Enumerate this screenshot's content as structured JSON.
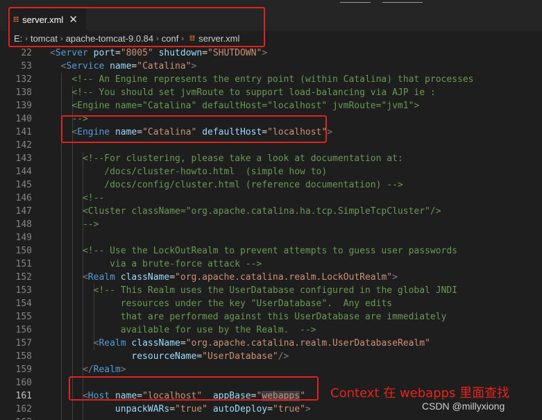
{
  "tab": {
    "file_name": "server.xml",
    "icon": "rss-icon",
    "close_label": "✕"
  },
  "breadcrumb": {
    "items": [
      "E:",
      "tomcat",
      "apache-tomcat-9.0.84",
      "conf",
      "server.xml"
    ],
    "separator": "›"
  },
  "editor": {
    "active_line": "161",
    "lines": [
      {
        "n": "22",
        "tokens": [
          {
            "t": "p",
            "v": "<"
          },
          {
            "t": "t",
            "v": "Server"
          },
          {
            "t": "txt",
            "v": " "
          },
          {
            "t": "a",
            "v": "port"
          },
          {
            "t": "txt",
            "v": "="
          },
          {
            "t": "s",
            "v": "\"8005\""
          },
          {
            "t": "txt",
            "v": " "
          },
          {
            "t": "a",
            "v": "shutdown"
          },
          {
            "t": "txt",
            "v": "="
          },
          {
            "t": "s",
            "v": "\"SHUTDOWN\""
          },
          {
            "t": "p",
            "v": ">"
          }
        ]
      },
      {
        "n": "53",
        "tokens": [
          {
            "t": "txt",
            "v": "  "
          },
          {
            "t": "p",
            "v": "<"
          },
          {
            "t": "t",
            "v": "Service"
          },
          {
            "t": "txt",
            "v": " "
          },
          {
            "t": "a",
            "v": "name"
          },
          {
            "t": "txt",
            "v": "="
          },
          {
            "t": "s",
            "v": "\"Catalina\""
          },
          {
            "t": "p",
            "v": ">"
          }
        ]
      },
      {
        "n": "132",
        "tokens": [
          {
            "t": "txt",
            "v": "    "
          },
          {
            "t": "c",
            "v": "<!-- An Engine represents the entry point (within Catalina) that processes"
          }
        ]
      },
      {
        "n": "138",
        "tokens": [
          {
            "t": "txt",
            "v": "    "
          },
          {
            "t": "c",
            "v": "<!-- You should set jvmRoute to support load-balancing via AJP ie :"
          }
        ]
      },
      {
        "n": "139",
        "tokens": [
          {
            "t": "txt",
            "v": "    "
          },
          {
            "t": "c",
            "v": "<Engine name=\"Catalina\" defaultHost=\"localhost\" jvmRoute=\"jvm1\">"
          }
        ]
      },
      {
        "n": "140",
        "tokens": [
          {
            "t": "txt",
            "v": "    "
          },
          {
            "t": "c",
            "v": "-->"
          }
        ]
      },
      {
        "n": "141",
        "tokens": [
          {
            "t": "txt",
            "v": "    "
          },
          {
            "t": "p",
            "v": "<"
          },
          {
            "t": "t",
            "v": "Engine"
          },
          {
            "t": "txt",
            "v": " "
          },
          {
            "t": "a",
            "v": "name"
          },
          {
            "t": "txt",
            "v": "="
          },
          {
            "t": "s",
            "v": "\"Catalina\""
          },
          {
            "t": "txt",
            "v": " "
          },
          {
            "t": "a",
            "v": "defaultHost"
          },
          {
            "t": "txt",
            "v": "="
          },
          {
            "t": "s",
            "v": "\"localhost\""
          },
          {
            "t": "p",
            "v": ">"
          }
        ]
      },
      {
        "n": "142",
        "tokens": []
      },
      {
        "n": "143",
        "tokens": [
          {
            "t": "txt",
            "v": "      "
          },
          {
            "t": "c",
            "v": "<!--For clustering, please take a look at documentation at:"
          }
        ]
      },
      {
        "n": "144",
        "tokens": [
          {
            "t": "txt",
            "v": "      "
          },
          {
            "t": "c",
            "v": "    /docs/cluster-howto.html  (simple how to)"
          }
        ]
      },
      {
        "n": "145",
        "tokens": [
          {
            "t": "txt",
            "v": "      "
          },
          {
            "t": "c",
            "v": "    /docs/config/cluster.html (reference documentation) -->"
          }
        ]
      },
      {
        "n": "146",
        "tokens": [
          {
            "t": "txt",
            "v": "      "
          },
          {
            "t": "c",
            "v": "<!--"
          }
        ]
      },
      {
        "n": "147",
        "tokens": [
          {
            "t": "txt",
            "v": "      "
          },
          {
            "t": "c",
            "v": "<Cluster className=\"org.apache.catalina.ha.tcp.SimpleTcpCluster\"/>"
          }
        ]
      },
      {
        "n": "148",
        "tokens": [
          {
            "t": "txt",
            "v": "      "
          },
          {
            "t": "c",
            "v": "-->"
          }
        ]
      },
      {
        "n": "149",
        "tokens": []
      },
      {
        "n": "150",
        "tokens": [
          {
            "t": "txt",
            "v": "      "
          },
          {
            "t": "c",
            "v": "<!-- Use the LockOutRealm to prevent attempts to guess user passwords"
          }
        ]
      },
      {
        "n": "151",
        "tokens": [
          {
            "t": "txt",
            "v": "      "
          },
          {
            "t": "c",
            "v": "     via a brute-force attack -->"
          }
        ]
      },
      {
        "n": "152",
        "tokens": [
          {
            "t": "txt",
            "v": "      "
          },
          {
            "t": "p",
            "v": "<"
          },
          {
            "t": "t",
            "v": "Realm"
          },
          {
            "t": "txt",
            "v": " "
          },
          {
            "t": "a",
            "v": "className"
          },
          {
            "t": "txt",
            "v": "="
          },
          {
            "t": "s",
            "v": "\"org.apache.catalina.realm.LockOutRealm\""
          },
          {
            "t": "p",
            "v": ">"
          }
        ]
      },
      {
        "n": "153",
        "tokens": [
          {
            "t": "txt",
            "v": "        "
          },
          {
            "t": "c",
            "v": "<!-- This Realm uses the UserDatabase configured in the global JNDI"
          }
        ]
      },
      {
        "n": "154",
        "tokens": [
          {
            "t": "txt",
            "v": "        "
          },
          {
            "t": "c",
            "v": "     resources under the key \"UserDatabase\".  Any edits"
          }
        ]
      },
      {
        "n": "155",
        "tokens": [
          {
            "t": "txt",
            "v": "        "
          },
          {
            "t": "c",
            "v": "     that are performed against this UserDatabase are immediately"
          }
        ]
      },
      {
        "n": "156",
        "tokens": [
          {
            "t": "txt",
            "v": "        "
          },
          {
            "t": "c",
            "v": "     available for use by the Realm.  -->"
          }
        ]
      },
      {
        "n": "157",
        "tokens": [
          {
            "t": "txt",
            "v": "        "
          },
          {
            "t": "p",
            "v": "<"
          },
          {
            "t": "t",
            "v": "Realm"
          },
          {
            "t": "txt",
            "v": " "
          },
          {
            "t": "a",
            "v": "className"
          },
          {
            "t": "txt",
            "v": "="
          },
          {
            "t": "s",
            "v": "\"org.apache.catalina.realm.UserDatabaseRealm\""
          }
        ]
      },
      {
        "n": "158",
        "tokens": [
          {
            "t": "txt",
            "v": "               "
          },
          {
            "t": "a",
            "v": "resourceName"
          },
          {
            "t": "txt",
            "v": "="
          },
          {
            "t": "s",
            "v": "\"UserDatabase\""
          },
          {
            "t": "p",
            "v": "/>"
          }
        ]
      },
      {
        "n": "159",
        "tokens": [
          {
            "t": "txt",
            "v": "      "
          },
          {
            "t": "p",
            "v": "</"
          },
          {
            "t": "t",
            "v": "Realm"
          },
          {
            "t": "p",
            "v": ">"
          }
        ]
      },
      {
        "n": "160",
        "tokens": []
      },
      {
        "n": "161",
        "tokens": [
          {
            "t": "txt",
            "v": "      "
          },
          {
            "t": "p",
            "v": "<"
          },
          {
            "t": "t",
            "v": "Host"
          },
          {
            "t": "txt",
            "v": " "
          },
          {
            "t": "a",
            "v": "name"
          },
          {
            "t": "txt",
            "v": "="
          },
          {
            "t": "s",
            "v": "\"localhost\""
          },
          {
            "t": "txt",
            "v": "  "
          },
          {
            "t": "a",
            "v": "appBase"
          },
          {
            "t": "txt",
            "v": "="
          },
          {
            "t": "s",
            "v": "\""
          },
          {
            "t": "s sel",
            "v": "webapps"
          },
          {
            "t": "s",
            "v": "\""
          }
        ]
      },
      {
        "n": "162",
        "tokens": [
          {
            "t": "txt",
            "v": "            "
          },
          {
            "t": "a",
            "v": "unpackWARs"
          },
          {
            "t": "txt",
            "v": "="
          },
          {
            "t": "s",
            "v": "\"true\""
          },
          {
            "t": "txt",
            "v": " "
          },
          {
            "t": "a",
            "v": "autoDeploy"
          },
          {
            "t": "txt",
            "v": "="
          },
          {
            "t": "s",
            "v": "\"true\""
          },
          {
            "t": "p",
            "v": ">"
          }
        ]
      },
      {
        "n": "163",
        "tokens": []
      }
    ]
  },
  "annotation": {
    "text": "Context 在 webapps 里面查找"
  },
  "watermark": {
    "text": "CSDN @millyxiong"
  },
  "colors": {
    "highlight_box": "#e0231c",
    "annotation": "#e8231c"
  }
}
